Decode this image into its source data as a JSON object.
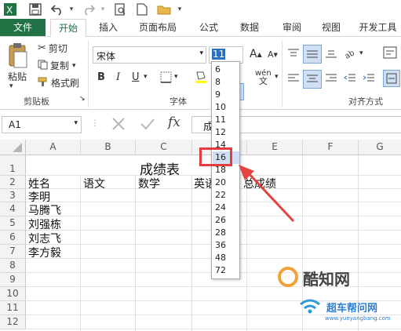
{
  "colors": {
    "excel_green": "#217346",
    "highlight_red": "#e33d3d",
    "arrow_red": "#e5433f"
  },
  "titlebar": {
    "icons": [
      "excel-logo-icon",
      "save-icon",
      "undo-icon",
      "redo-icon",
      "print-preview-icon",
      "new-file-icon",
      "open-folder-icon"
    ]
  },
  "tabs": [
    {
      "label": "文件"
    },
    {
      "label": "开始"
    },
    {
      "label": "插入"
    },
    {
      "label": "页面布局"
    },
    {
      "label": "公式"
    },
    {
      "label": "数据"
    },
    {
      "label": "审阅"
    },
    {
      "label": "视图"
    },
    {
      "label": "开发工具"
    }
  ],
  "ribbon": {
    "clipboard": {
      "paste": "粘贴",
      "cut": "剪切",
      "copy": "复制",
      "format_painter": "格式刷",
      "group_label": "剪贴板"
    },
    "font": {
      "font_name": "宋体",
      "font_size": "11",
      "bold": "B",
      "italic": "I",
      "underline": "U",
      "grow": "A",
      "shrink": "A",
      "group_label": "字体",
      "wen": "wén"
    },
    "alignment": {
      "group_label": "对齐方式"
    }
  },
  "formula_bar": {
    "name_box": "A1",
    "fx": "fx",
    "value": "成"
  },
  "columns": [
    "A",
    "B",
    "C",
    "D",
    "E",
    "F",
    "G"
  ],
  "rows": [
    "1",
    "2",
    "3",
    "4",
    "5",
    "6",
    "7",
    "8",
    "9",
    "10",
    "11",
    "12"
  ],
  "cells": {
    "title": "成绩表",
    "h_name": "姓名",
    "h_chinese": "语文",
    "h_math": "数学",
    "h_english": "英语",
    "h_total": "总成绩",
    "names": [
      "李明",
      "马腾飞",
      "刘强栋",
      "刘志飞",
      "李方毅"
    ]
  },
  "font_size_dropdown": {
    "options": [
      "6",
      "8",
      "9",
      "10",
      "11",
      "12",
      "14",
      "16",
      "18",
      "20",
      "22",
      "24",
      "26",
      "28",
      "36",
      "48",
      "72"
    ],
    "selected": "16"
  },
  "watermark": {
    "brand": "酷知网",
    "site": "超车帮问网",
    "url": "www.yueyangbang.com"
  }
}
